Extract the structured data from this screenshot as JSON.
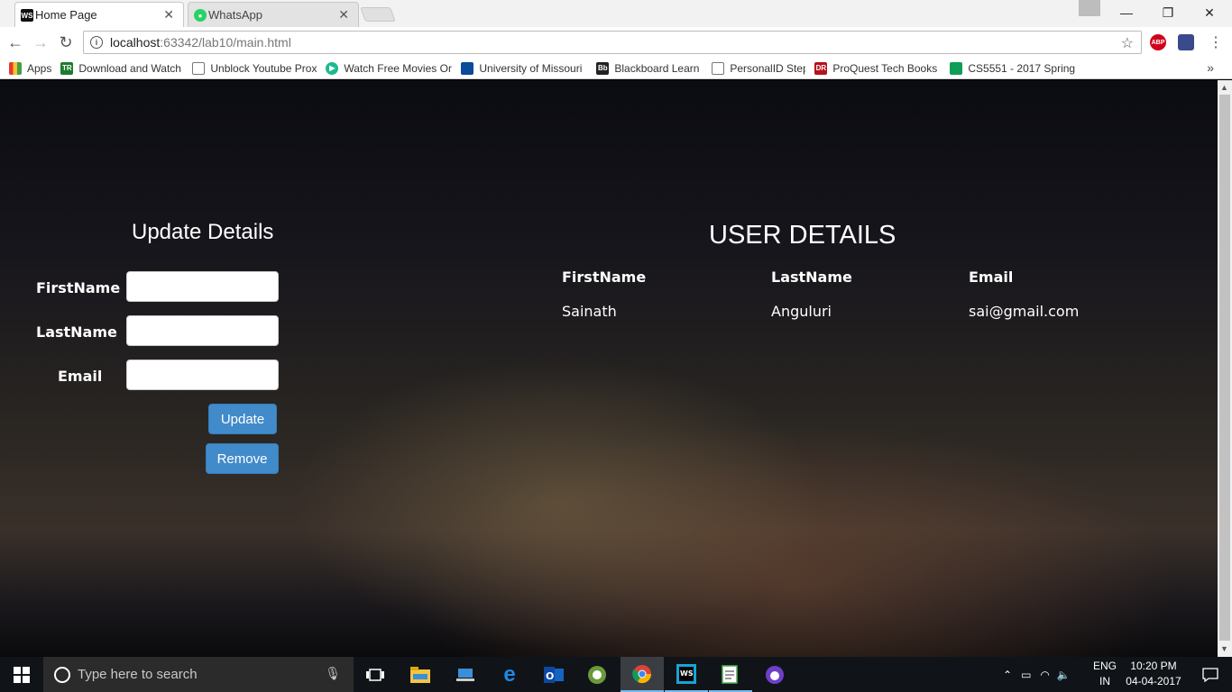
{
  "browser": {
    "tabs": [
      {
        "label": "Home Page",
        "icon": "webstorm-icon",
        "active": true
      },
      {
        "label": "WhatsApp",
        "icon": "whatsapp-icon",
        "active": false
      }
    ],
    "url_host": "localhost",
    "url_path": ":63342/lab10/main.html",
    "extensions": [
      "ABP"
    ],
    "bookmarks": [
      {
        "label": "Apps",
        "icon": "apps-grid-icon"
      },
      {
        "label": "Download and Watch",
        "icon": "tr-icon"
      },
      {
        "label": "Unblock Youtube Prox",
        "icon": "page-icon"
      },
      {
        "label": "Watch Free Movies Or",
        "icon": "play-icon"
      },
      {
        "label": "University of Missouri",
        "icon": "umkc-icon"
      },
      {
        "label": "Blackboard Learn",
        "icon": "blackboard-icon"
      },
      {
        "label": "PersonalID Step",
        "icon": "page-icon"
      },
      {
        "label": "ProQuest Tech Books",
        "icon": "proquest-icon"
      },
      {
        "label": "CS5551 - 2017 Spring",
        "icon": "sheets-icon"
      }
    ],
    "more_label": "»"
  },
  "page": {
    "form": {
      "title": "Update Details",
      "firstname_label": "FirstName",
      "lastname_label": "LastName",
      "email_label": "Email",
      "firstname_value": "",
      "lastname_value": "",
      "email_value": "",
      "update_label": "Update",
      "remove_label": "Remove"
    },
    "table": {
      "title": "USER DETAILS",
      "headers": [
        "FirstName",
        "LastName",
        "Email"
      ],
      "rows": [
        [
          "Sainath",
          "Anguluri",
          "sai@gmail.com"
        ]
      ]
    }
  },
  "taskbar": {
    "search_placeholder": "Type here to search",
    "lang_line1": "ENG",
    "lang_line2": "IN",
    "time": "10:20 PM",
    "date": "04-04-2017"
  },
  "colors": {
    "button_blue": "#428bca",
    "taskbar": "#101418"
  }
}
